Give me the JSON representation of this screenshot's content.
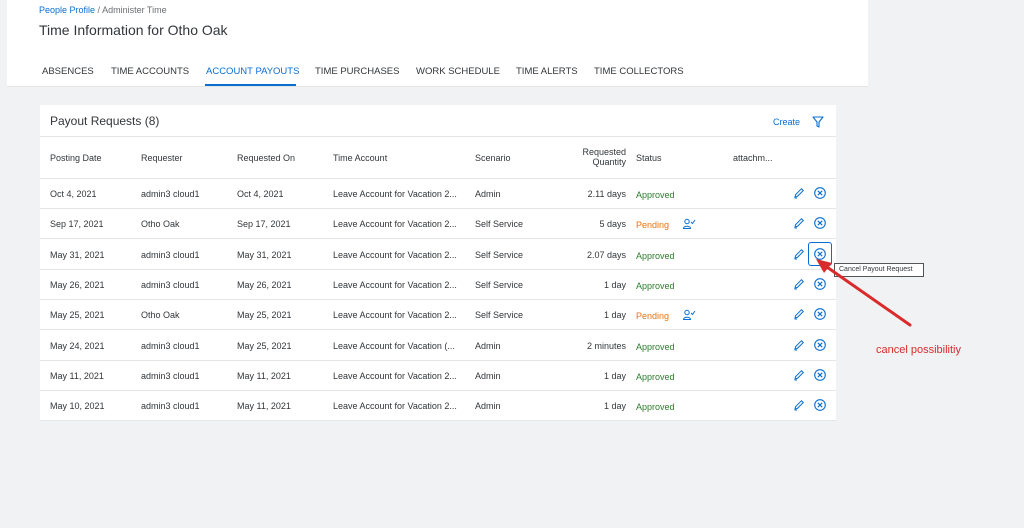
{
  "header": {
    "breadcrumb_link": "People Profile",
    "breadcrumb_sep": " / ",
    "breadcrumb_current": "Administer Time",
    "title": "Time Information for Otho Oak"
  },
  "tabs": [
    {
      "label": "ABSENCES"
    },
    {
      "label": "TIME ACCOUNTS"
    },
    {
      "label": "ACCOUNT PAYOUTS",
      "active": true
    },
    {
      "label": "TIME PURCHASES"
    },
    {
      "label": "WORK SCHEDULE"
    },
    {
      "label": "TIME ALERTS"
    },
    {
      "label": "TIME COLLECTORS"
    }
  ],
  "panel": {
    "title": "Payout Requests (8)",
    "create_label": "Create",
    "filter_icon": "filter-icon"
  },
  "table": {
    "columns": {
      "posting_date": "Posting Date",
      "requester": "Requester",
      "requested_on": "Requested On",
      "time_account": "Time Account",
      "scenario": "Scenario",
      "quantity_line1": "Requested",
      "quantity_line2": "Quantity",
      "status": "Status",
      "attachments": "attachm..."
    },
    "rows": [
      {
        "posting_date": "Oct 4, 2021",
        "requester": "admin3 cloud1",
        "requested_on": "Oct 4, 2021",
        "time_account": "Leave Account for Vacation 2...",
        "scenario": "Admin",
        "quantity": "2.11 days",
        "status": "Approved"
      },
      {
        "posting_date": "Sep 17, 2021",
        "requester": "Otho Oak",
        "requested_on": "Sep 17, 2021",
        "time_account": "Leave Account for Vacation 2...",
        "scenario": "Self Service",
        "quantity": "5 days",
        "status": "Pending"
      },
      {
        "posting_date": "May 31, 2021",
        "requester": "admin3 cloud1",
        "requested_on": "May 31, 2021",
        "time_account": "Leave Account for Vacation 2...",
        "scenario": "Self Service",
        "quantity": "2.07 days",
        "status": "Approved"
      },
      {
        "posting_date": "May 26, 2021",
        "requester": "admin3 cloud1",
        "requested_on": "May 26, 2021",
        "time_account": "Leave Account for Vacation 2...",
        "scenario": "Self Service",
        "quantity": "1 day",
        "status": "Approved"
      },
      {
        "posting_date": "May 25, 2021",
        "requester": "Otho Oak",
        "requested_on": "May 25, 2021",
        "time_account": "Leave Account for Vacation 2...",
        "scenario": "Self Service",
        "quantity": "1 day",
        "status": "Pending"
      },
      {
        "posting_date": "May 24, 2021",
        "requester": "admin3 cloud1",
        "requested_on": "May 25, 2021",
        "time_account": "Leave Account for Vacation (...",
        "scenario": "Admin",
        "quantity": "2 minutes",
        "status": "Approved"
      },
      {
        "posting_date": "May 11, 2021",
        "requester": "admin3 cloud1",
        "requested_on": "May 11, 2021",
        "time_account": "Leave Account for Vacation 2...",
        "scenario": "Admin",
        "quantity": "1 day",
        "status": "Approved"
      },
      {
        "posting_date": "May 10, 2021",
        "requester": "admin3 cloud1",
        "requested_on": "May 11, 2021",
        "time_account": "Leave Account for Vacation 2...",
        "scenario": "Admin",
        "quantity": "1 day",
        "status": "Approved"
      }
    ]
  },
  "tooltip": "Cancel Payout Request",
  "annotation": "cancel possibilitiy",
  "colors": {
    "accent": "#0a6ed1",
    "approved": "#2b7c2b",
    "pending": "#e9730c",
    "annotation": "#d92b2b"
  }
}
